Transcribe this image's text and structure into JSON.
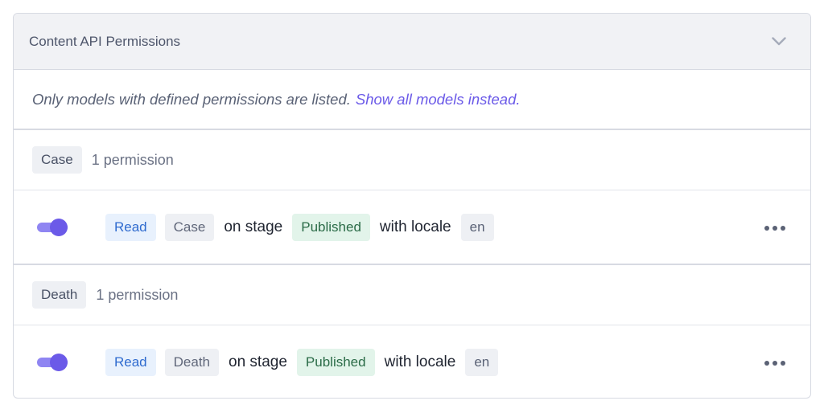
{
  "panel": {
    "title": "Content API Permissions",
    "notice": "Only models with defined permissions are listed.",
    "notice_link": "Show all models instead."
  },
  "groups": [
    {
      "model": "Case",
      "count": "1 permission",
      "permission": {
        "action": "Read",
        "model": "Case",
        "on_stage": "on stage",
        "stage": "Published",
        "with_locale": "with locale",
        "locale": "en",
        "enabled": true
      }
    },
    {
      "model": "Death",
      "count": "1 permission",
      "permission": {
        "action": "Read",
        "model": "Death",
        "on_stage": "on stage",
        "stage": "Published",
        "with_locale": "with locale",
        "locale": "en",
        "enabled": true
      }
    }
  ],
  "icons": {
    "chevron": "chevron-down-icon",
    "more": "more-horizontal-icon"
  },
  "colors": {
    "accent": "#6b5ae8",
    "header_bg": "#f1f2f5",
    "read_chip": "#e8f1fd",
    "published_chip": "#e2f4ea"
  }
}
